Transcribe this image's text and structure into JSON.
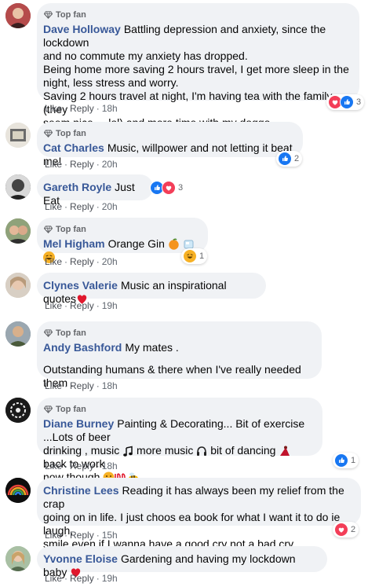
{
  "labels": {
    "top_fan": "Top fan",
    "like": "Like",
    "reply": "Reply",
    "dot": "·"
  },
  "colors": {
    "name": "#385898",
    "bubble": "#f0f2f5",
    "like": "#1877f2",
    "love": "#f33e58",
    "haha": "#f7b125"
  },
  "comments": [
    {
      "name": "Dave Holloway",
      "top_fan": true,
      "lines": [
        "Battling depression and anxiety, since the lockdown",
        "and no commute my anxiety has dropped.",
        "Being home more saving 2 hours travel, I get more sleep in the",
        "night, less stress and worry.",
        "Saving 2 hours travel at night, I'm having tea with the family (they",
        "seem nice.... lol) and more time with my doggo."
      ],
      "time": "18h",
      "reactions": [
        "love-icon",
        "like-icon"
      ],
      "reaction_count": "3"
    },
    {
      "name": "Cat Charles",
      "top_fan": true,
      "text": "Music, willpower and not letting it beat me!",
      "time": "20h",
      "reactions": [
        "like-icon"
      ],
      "reaction_count": "2"
    },
    {
      "name": "Gareth Royle",
      "top_fan": false,
      "text": "Just Eat",
      "time": "20h",
      "reactions": [
        "like-icon",
        "love-icon"
      ],
      "reaction_count": "3"
    },
    {
      "name": "Mel Higham",
      "top_fan": true,
      "text": "Orange Gin",
      "emojis": [
        "orange-emoji",
        "ice-cube-emoji",
        "laughing-emoji"
      ],
      "time": "20h",
      "reactions": [
        "haha-icon"
      ],
      "reaction_count": "1"
    },
    {
      "name": "Clynes Valerie",
      "top_fan": false,
      "text": "Music an inspirational quotes",
      "emojis": [
        "red-heart-emoji"
      ],
      "time": "19h"
    },
    {
      "name": "Andy Bashford",
      "top_fan": true,
      "text": "My mates .",
      "text2": "Outstanding humans & there when I've really needed them .",
      "time": "18h"
    },
    {
      "name": "Diane Burney",
      "top_fan": true,
      "line1": "Painting & Decorating... Bit of exercise ...Lots of beer",
      "line2a": "drinking , music",
      "line2b": "more music",
      "line2c": "bit of dancing",
      "line2d": "back to work",
      "line3": "now though",
      "time": "18h",
      "reactions": [
        "like-icon"
      ],
      "reaction_count": "1"
    },
    {
      "name": "Christine Lees",
      "top_fan": false,
      "line1": "Reading it has always been my relief from the crap",
      "line2": "going on in life. I just choos ea book for what I want it to do ie laugh,",
      "line3": "smile even if I wanna have a good cry not a bad cry",
      "time": "15h",
      "reactions": [
        "love-icon"
      ],
      "reaction_count": "2"
    },
    {
      "name": "Yvonne Eloise",
      "top_fan": false,
      "text": "Gardening and having my lockdown baby",
      "emojis": [
        "red-heart-emoji"
      ],
      "time": "19h"
    }
  ]
}
